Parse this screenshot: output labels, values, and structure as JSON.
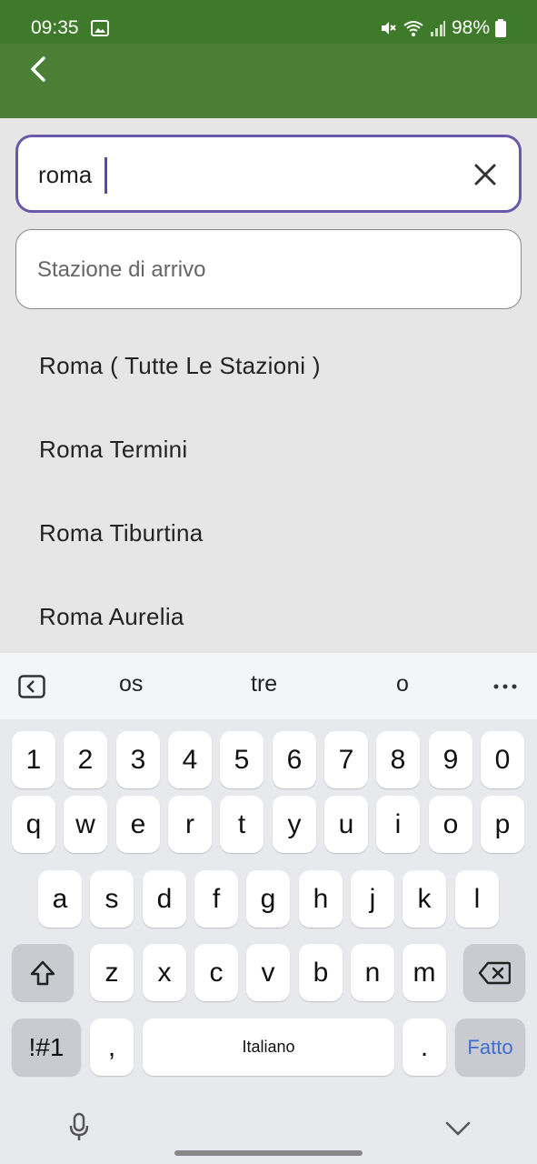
{
  "status_bar": {
    "time": "09:35",
    "battery": "98%"
  },
  "colors": {
    "app_bar": "#4b7f35",
    "status_bar": "#3f7a2b",
    "focus_border": "#6a58a8",
    "fatto_blue": "#3b6fd6"
  },
  "search": {
    "departure_value": "roma",
    "arrival_placeholder": "Stazione di arrivo"
  },
  "suggestions": [
    {
      "label": "Roma ( Tutte Le Stazioni )"
    },
    {
      "label": "Roma Termini"
    },
    {
      "label": "Roma Tiburtina"
    },
    {
      "label": "Roma Aurelia"
    }
  ],
  "keyboard": {
    "suggestions": [
      "os",
      "tre",
      "o"
    ],
    "numbers": [
      "1",
      "2",
      "3",
      "4",
      "5",
      "6",
      "7",
      "8",
      "9",
      "0"
    ],
    "row1": [
      "q",
      "w",
      "e",
      "r",
      "t",
      "y",
      "u",
      "i",
      "o",
      "p"
    ],
    "row2": [
      "a",
      "s",
      "d",
      "f",
      "g",
      "h",
      "j",
      "k",
      "l"
    ],
    "row3": [
      "z",
      "x",
      "c",
      "v",
      "b",
      "n",
      "m"
    ],
    "symbols_label": "!#1",
    "comma": ",",
    "space_label": "Italiano",
    "period": ".",
    "done_label": "Fatto"
  }
}
